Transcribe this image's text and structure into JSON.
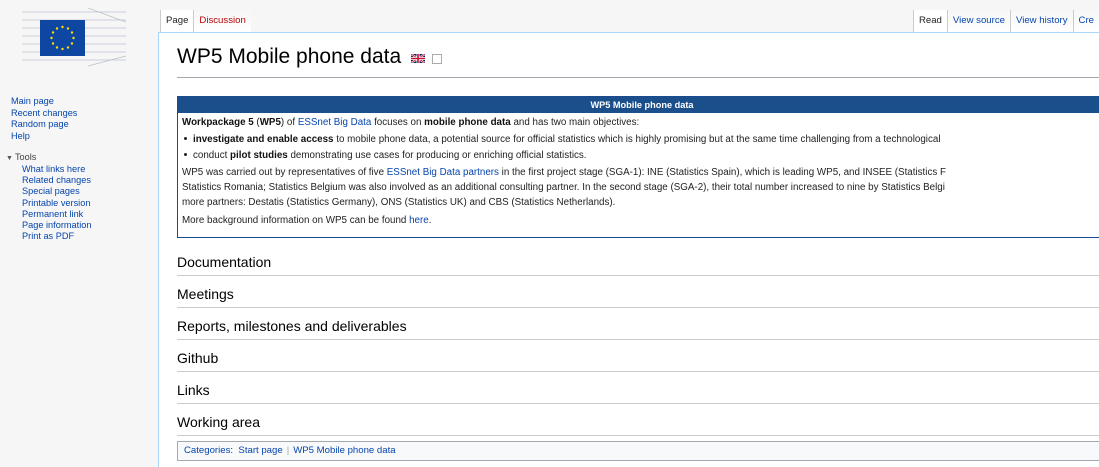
{
  "sidebar": {
    "nav": [
      "Main page",
      "Recent changes",
      "Random page",
      "Help"
    ],
    "tools_label": "Tools",
    "tools": [
      "What links here",
      "Related changes",
      "Special pages",
      "Printable version",
      "Permanent link",
      "Page information",
      "Print as PDF"
    ]
  },
  "tabs": {
    "page": "Page",
    "discussion": "Discussion",
    "read": "Read",
    "view_source": "View source",
    "view_history": "View history",
    "more": "Cre"
  },
  "page": {
    "title": "WP5 Mobile phone data"
  },
  "infobox": {
    "header": "WP5 Mobile phone data",
    "intro": {
      "wp_bold": "Workpackage 5",
      "open_paren": " (",
      "wp_abbr": "WP5",
      "mid1": ") of ",
      "essnet_link": "ESSnet Big Data",
      "mid2": " focuses on ",
      "mobile_bold": "mobile phone data",
      "end": " and has two main objectives:"
    },
    "bullet1": {
      "bold": "investigate and enable access",
      "rest": " to mobile phone data, a potential source for official statistics which is highly promising but at the same time challenging from a technological"
    },
    "bullet2": {
      "pre": "conduct ",
      "bold": "pilot studies",
      "rest": " demonstrating use cases for producing or enriching official statistics."
    },
    "para1": {
      "pre": "WP5 was carried out by representatives of five ",
      "link": "ESSnet Big Data partners",
      "post": " in the first project stage (SGA-1): INE (Statistics Spain), which is leading WP5, and INSEE (Statistics F"
    },
    "para2": "Statistics Romania; Statistics Belgium was also involved as an additional consulting partner. In the second stage (SGA-2), their total number increased to nine by Statistics Belgi",
    "para3": "more partners: Destatis (Statistics Germany), ONS (Statistics UK) and CBS (Statistics Netherlands).",
    "more": {
      "pre": "More background information on WP5 can be found ",
      "link": "here",
      "post": "."
    }
  },
  "sections": [
    "Documentation",
    "Meetings",
    "Reports, milestones and deliverables",
    "Github",
    "Links",
    "Working area"
  ],
  "categories": {
    "label": "Categories",
    "colon": ":",
    "items": [
      "Start page",
      "WP5 Mobile phone data"
    ]
  },
  "colors": {
    "link": "#0645ad",
    "infobox_header": "#1b4f8c",
    "eu_blue": "#0e47a1",
    "eu_star": "#ffdd00"
  }
}
